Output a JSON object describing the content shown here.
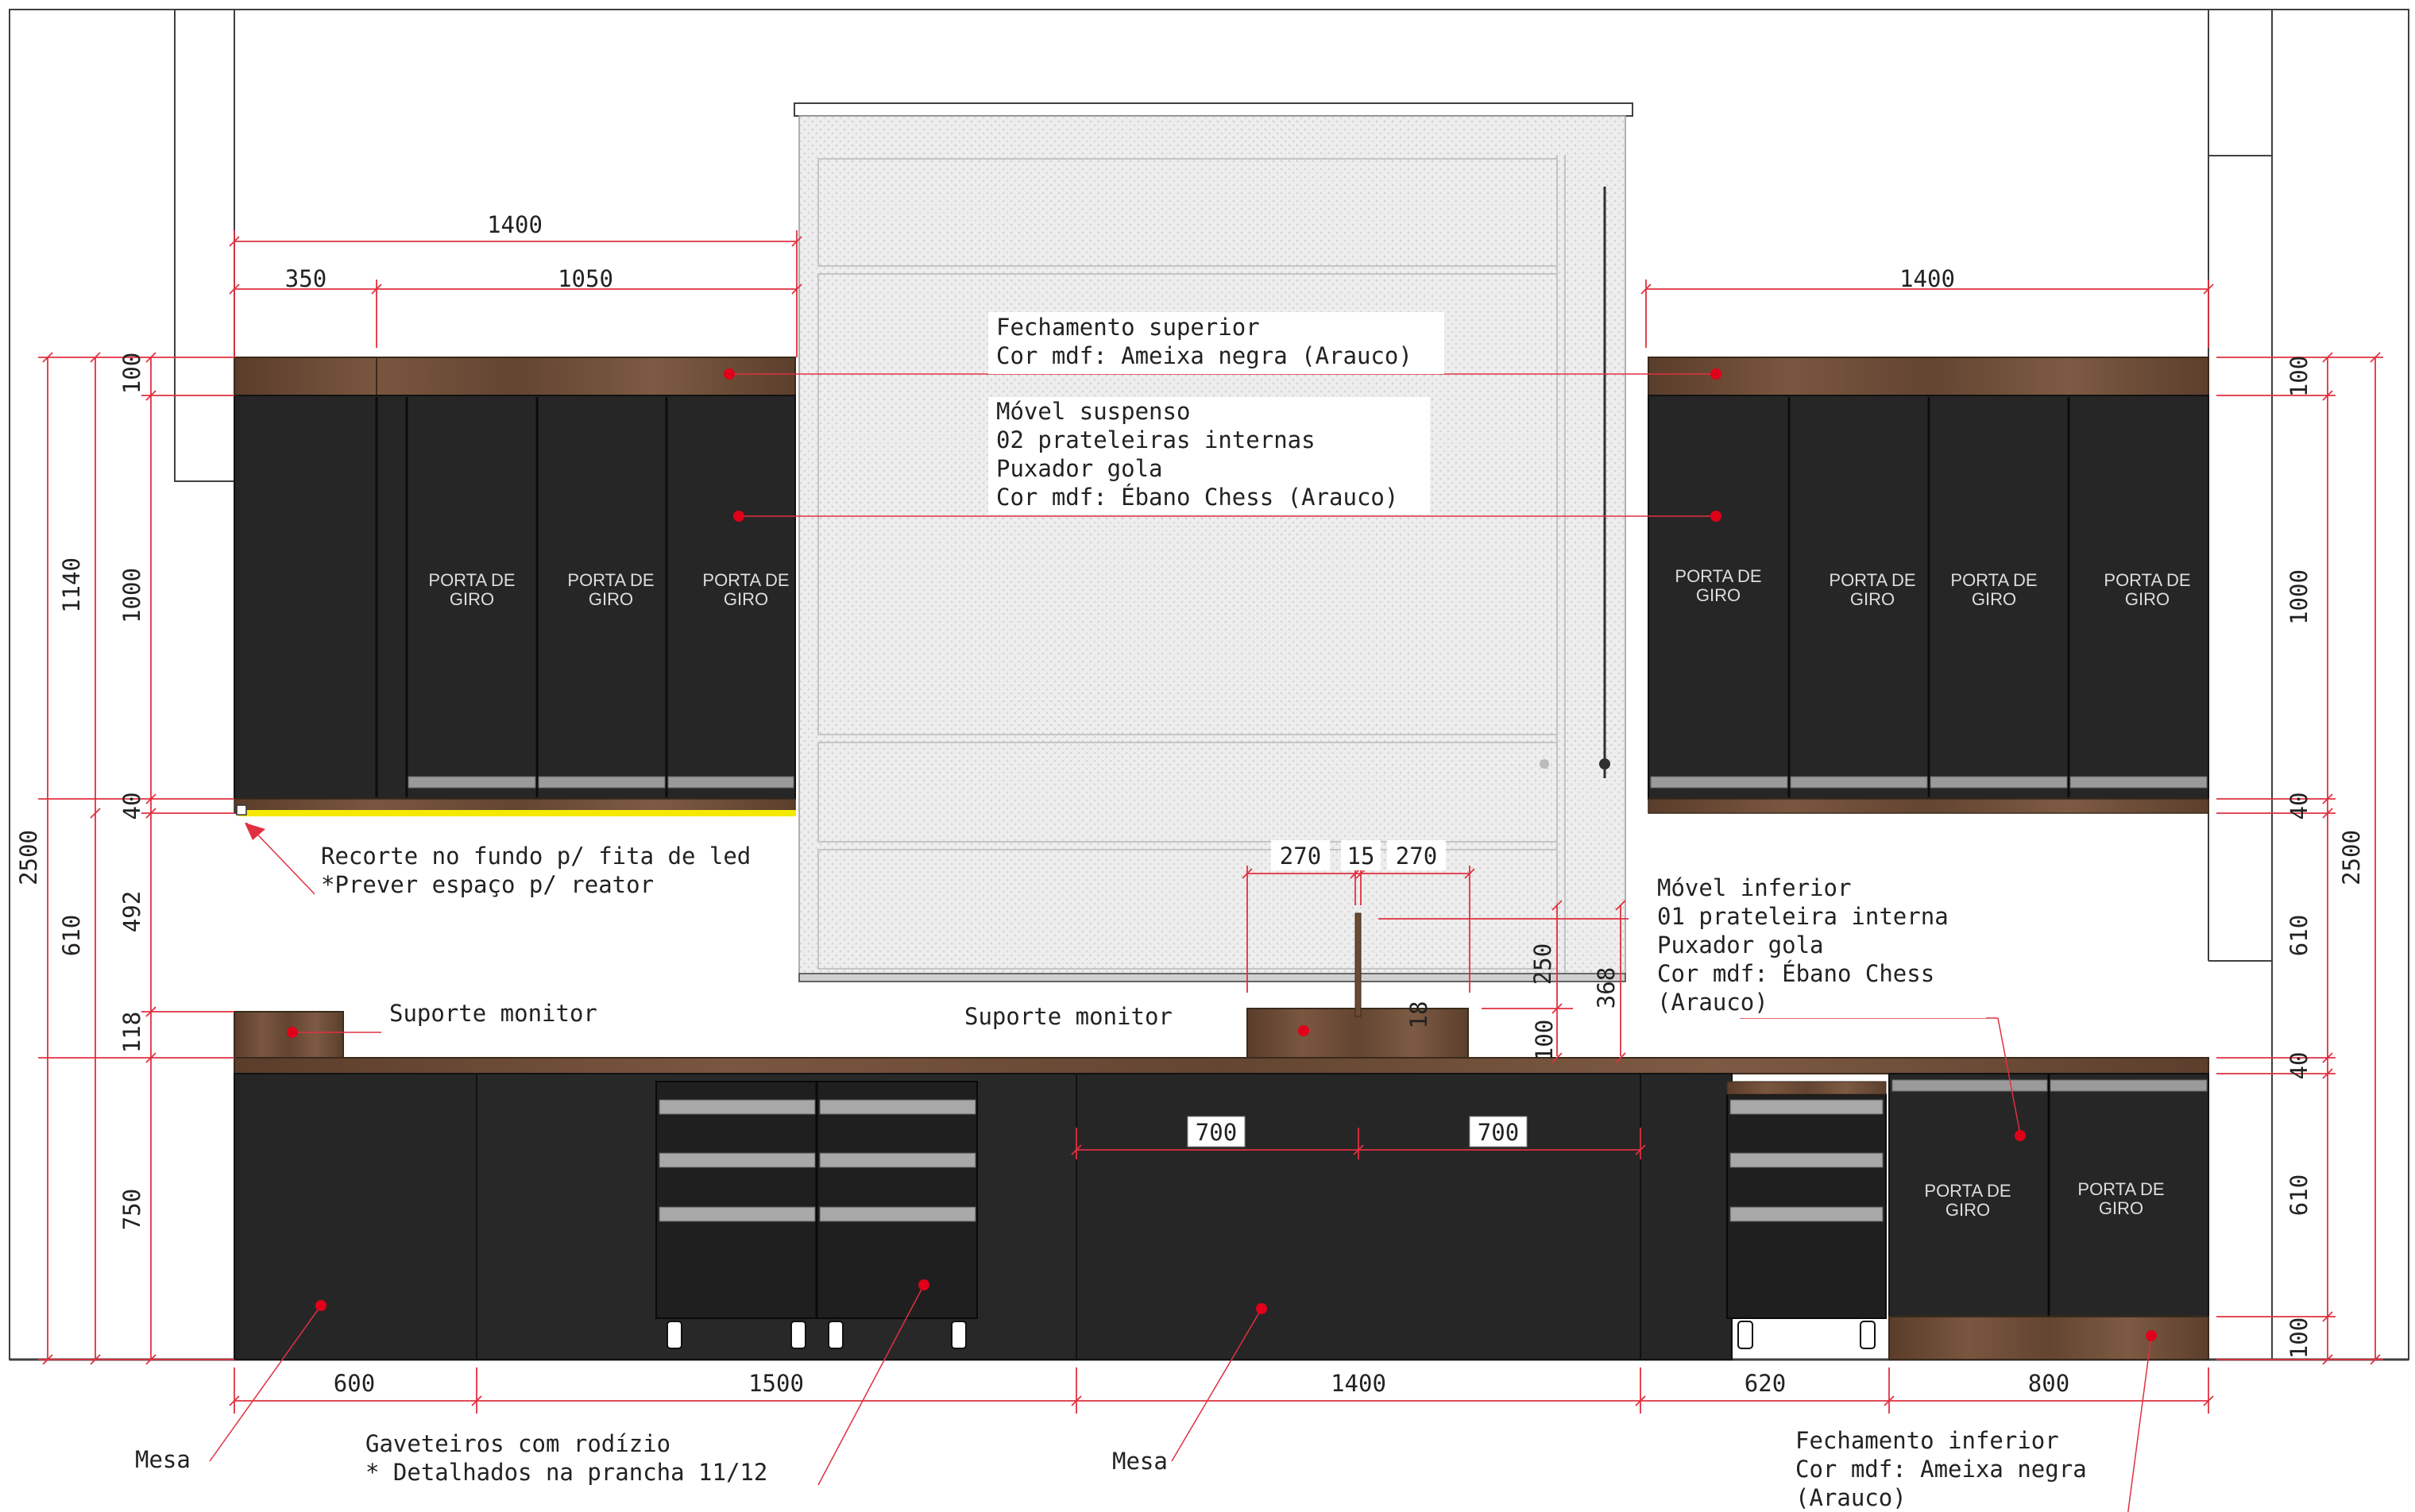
{
  "colors": {
    "dimension": "#e03040",
    "marker": "#e0001a",
    "cabinet": "#262626",
    "wood": "#6b4a33",
    "led": "#f5e900",
    "panel": "#ececec",
    "outline": "#404040"
  },
  "door_label": [
    "PORTA DE",
    "GIRO"
  ],
  "dimensions": {
    "top": {
      "left_total": "1400",
      "left_a": "350",
      "left_b": "1050",
      "right_total": "1400"
    },
    "bottom": [
      "600",
      "1500",
      "1400",
      "620",
      "800"
    ],
    "left_outer": {
      "total": "2500",
      "upper": "1140",
      "lower": "610"
    },
    "left_inner": {
      "top": "100",
      "cabinet": "1000",
      "base": "40",
      "gap": "492",
      "support": "118",
      "lower": "750"
    },
    "right_outer": {
      "total": "2500"
    },
    "right_inner": {
      "top": "100",
      "cabinet": "1000",
      "base": "40",
      "gap": "610",
      "counter": "40",
      "lower": "610",
      "plinth": "100"
    },
    "monitor": {
      "left": "270",
      "mid": "15",
      "right": "270",
      "post": "18",
      "height_a": "250",
      "height_b": "368",
      "height_c": "100",
      "desk_left": "700",
      "desk_right": "700"
    }
  },
  "notes": {
    "fechamento_superior": [
      "Fechamento superior",
      "Cor mdf: Ameixa negra (Arauco)"
    ],
    "movel_suspenso": [
      "Móvel suspenso",
      "02 prateleiras internas",
      "Puxador gola",
      "Cor mdf: Ébano Chess (Arauco)"
    ],
    "recorte": [
      "Recorte no fundo p/ fita de led",
      "*Prever espaço p/ reator"
    ],
    "suporte_monitor_left": "Suporte monitor",
    "suporte_monitor_center": "Suporte monitor",
    "movel_inferior": [
      "Móvel inferior",
      "01 prateleira interna",
      "Puxador gola",
      "Cor mdf: Ébano Chess",
      "(Arauco)"
    ],
    "mesa_left": "Mesa",
    "gaveteiros": [
      "Gaveteiros com rodízio",
      "* Detalhados na prancha 11/12"
    ],
    "mesa_center": "Mesa",
    "fechamento_inferior": [
      "Fechamento inferior",
      "Cor mdf: Ameixa negra",
      "(Arauco)"
    ]
  }
}
